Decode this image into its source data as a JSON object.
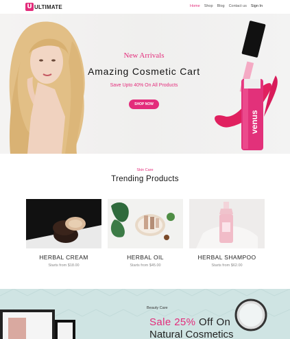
{
  "brand": {
    "mark": "U",
    "name": "ULTIMATE"
  },
  "nav": {
    "items": [
      "Home",
      "Shop",
      "Blog",
      "Contact us",
      "Sign In"
    ]
  },
  "hero": {
    "eyebrow": "New Arrivals",
    "title": "Amazing Cosmetic Cart",
    "subtitle": "Save Upto 40% On All Products",
    "button": "SHOP NOW",
    "product_brand": "venus"
  },
  "section": {
    "eyebrow": "Skin Care",
    "title": "Trending Products"
  },
  "products": [
    {
      "name": "HERBAL CREAM",
      "price": "Starts from $18.00"
    },
    {
      "name": "HERBAL OIL",
      "price": "Starts from $45.00"
    },
    {
      "name": "HERBAL SHAMPOO",
      "price": "Starts from $62.00"
    }
  ],
  "banner": {
    "eyebrow": "Beauty Care",
    "sale_pink": "Sale 25%",
    "sale_rest": " Off On",
    "line2": "Natural Cosmetics"
  },
  "colors": {
    "accent": "#e32c7b"
  }
}
